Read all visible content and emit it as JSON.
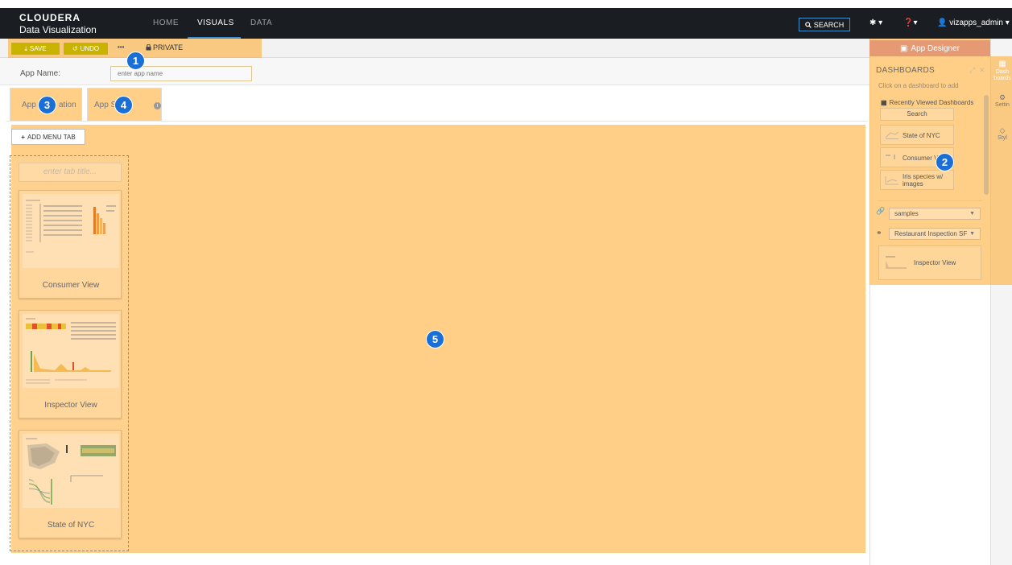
{
  "nav": {
    "brand_top": "CLOUDERA",
    "brand_bottom": "Data Visualization",
    "links": [
      "HOME",
      "VISUALS",
      "DATA"
    ],
    "active_link": "VISUALS",
    "search_label": "SEARCH",
    "user_label": "vizapps_admin"
  },
  "toolbar": {
    "save_label": "SAVE",
    "undo_label": "UNDO",
    "more_label": "•••",
    "privacy_label": "PRIVATE"
  },
  "app_name": {
    "label": "App Name:",
    "placeholder": "enter app name",
    "value": ""
  },
  "tabs": {
    "tab3_visible_a": "App",
    "tab3_visible_b": "ation",
    "tab4_visible": "App S"
  },
  "menu": {
    "add_tab_label": "ADD MENU TAB",
    "tab_title_placeholder": "enter tab title...",
    "cards": [
      {
        "caption": "Consumer View"
      },
      {
        "caption": "Inspector View"
      },
      {
        "caption": "State of NYC"
      }
    ]
  },
  "panel": {
    "title": "App Designer",
    "dashboards_header": "DASHBOARDS",
    "hint": "Click on a dashboard to add",
    "recent_label": "Recently Viewed Dashboards",
    "search_label": "Search",
    "dashboards": [
      {
        "label": "State of NYC"
      },
      {
        "label": "Consumer V"
      },
      {
        "label": "Iris species w/ images"
      }
    ],
    "connection_select": "samples",
    "dataset_select": "Restaurant Inspection SF",
    "dataset_card": "Inspector View",
    "side_tabs": [
      "Dash boards",
      "Settin",
      "Styl"
    ]
  },
  "badges": [
    "1",
    "2",
    "3",
    "4",
    "5"
  ],
  "colors": {
    "highlight": "#ffa726",
    "badge": "#1a6fd6",
    "nav_bg": "#1a1d21",
    "save_btn": "#c8b400",
    "designer_bar": "#e59a74"
  }
}
